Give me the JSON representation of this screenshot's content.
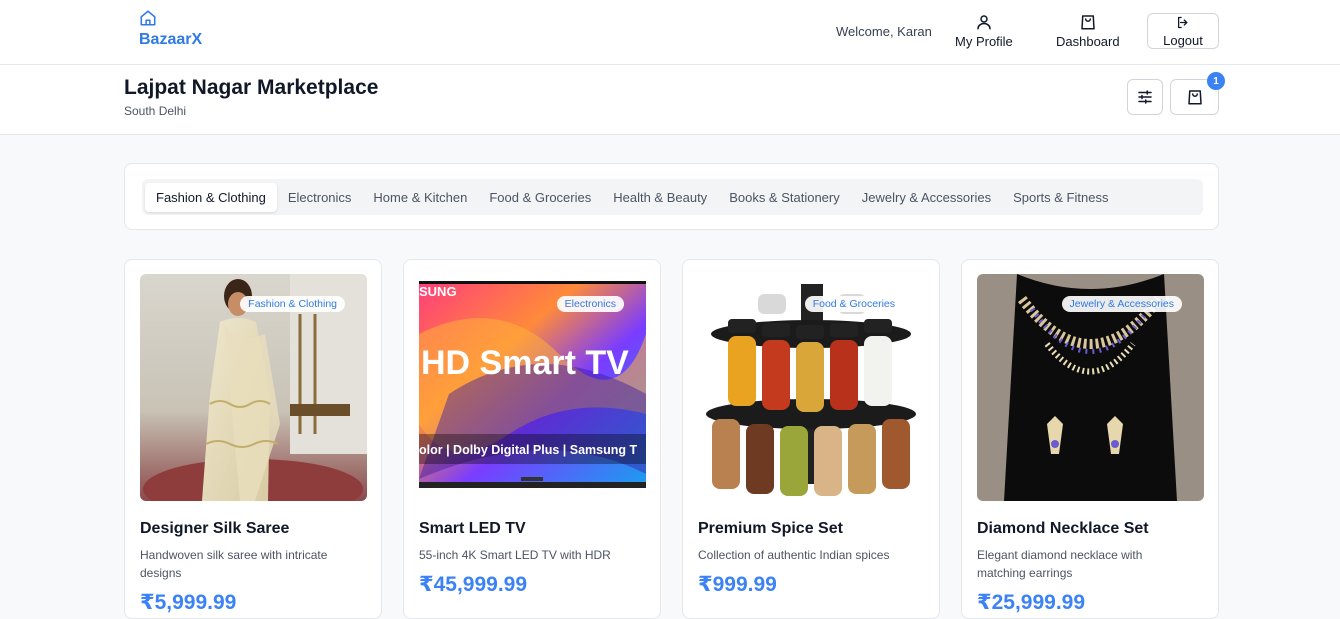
{
  "brand": {
    "name": "BazaarX",
    "icon": "home-icon"
  },
  "nav": {
    "welcome": "Welcome, Karan",
    "profile_label": "My Profile",
    "dashboard_label": "Dashboard",
    "logout_label": "Logout"
  },
  "market": {
    "title": "Lajpat Nagar Marketplace",
    "subtitle": "South Delhi",
    "cart_count": "1"
  },
  "categories": [
    "Fashion & Clothing",
    "Electronics",
    "Home & Kitchen",
    "Food & Groceries",
    "Health & Beauty",
    "Books & Stationery",
    "Jewelry & Accessories",
    "Sports & Fitness"
  ],
  "active_category": "Fashion & Clothing",
  "products": [
    {
      "name": "Designer Silk Saree",
      "description": "Handwoven silk saree with intricate designs",
      "price": "₹5,999.99",
      "category": "Fashion & Clothing"
    },
    {
      "name": "Smart LED TV",
      "description": "55-inch 4K Smart LED TV with HDR",
      "price": "₹45,999.99",
      "category": "Electronics",
      "image_text": {
        "brand": "SUNG",
        "headline": "HD Smart TV",
        "features": "olor  |  Dolby Digital Plus  |  Samsung T"
      }
    },
    {
      "name": "Premium Spice Set",
      "description": "Collection of authentic Indian spices",
      "price": "₹999.99",
      "category": "Food & Groceries"
    },
    {
      "name": "Diamond Necklace Set",
      "description": "Elegant diamond necklace with matching earrings",
      "price": "₹25,999.99",
      "category": "Jewelry & Accessories"
    }
  ],
  "colors": {
    "accent": "#3b82f6",
    "brand": "#2f7ae5"
  }
}
